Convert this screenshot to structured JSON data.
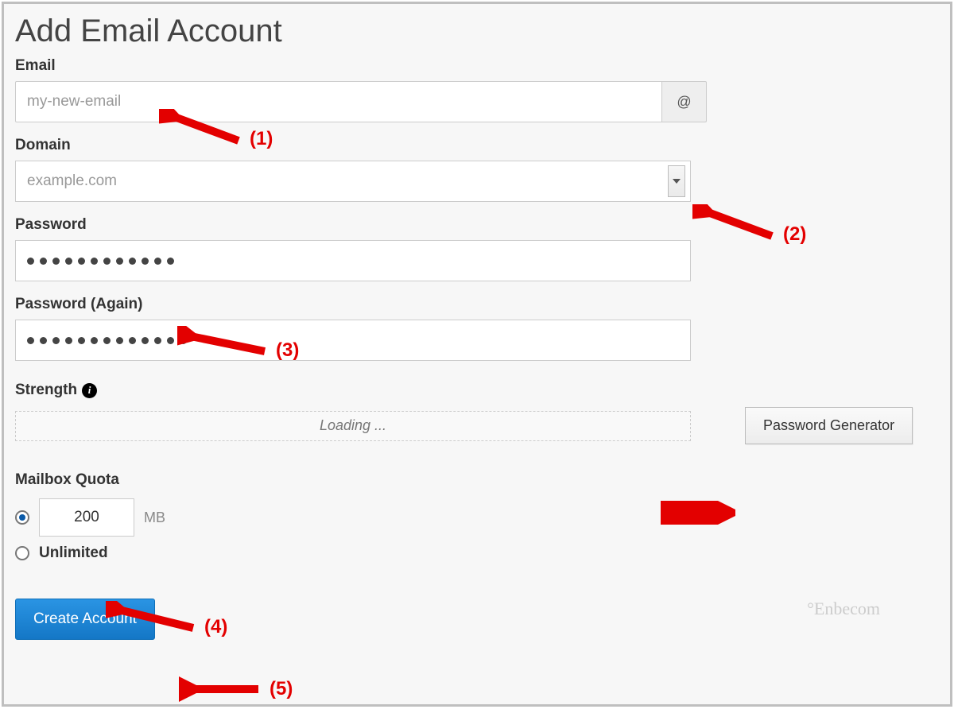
{
  "page": {
    "title": "Add Email Account"
  },
  "email": {
    "label": "Email",
    "value": "my-new-email",
    "at_symbol": "@"
  },
  "domain": {
    "label": "Domain",
    "value": "example.com"
  },
  "password": {
    "label": "Password",
    "dot_count": 12
  },
  "password_again": {
    "label": "Password (Again)",
    "dot_count": 13
  },
  "strength": {
    "label": "Strength",
    "status": "Loading ...",
    "generator_button": "Password Generator"
  },
  "quota": {
    "label": "Mailbox Quota",
    "amount": "200",
    "unit": "MB",
    "unlimited_label": "Unlimited",
    "selected": "amount"
  },
  "submit": {
    "label": "Create Account"
  },
  "watermark": "°Enbecom",
  "annotations": {
    "a1": "(1)",
    "a2": "(2)",
    "a3": "(3)",
    "a4": "(4)",
    "a5": "(5)"
  }
}
